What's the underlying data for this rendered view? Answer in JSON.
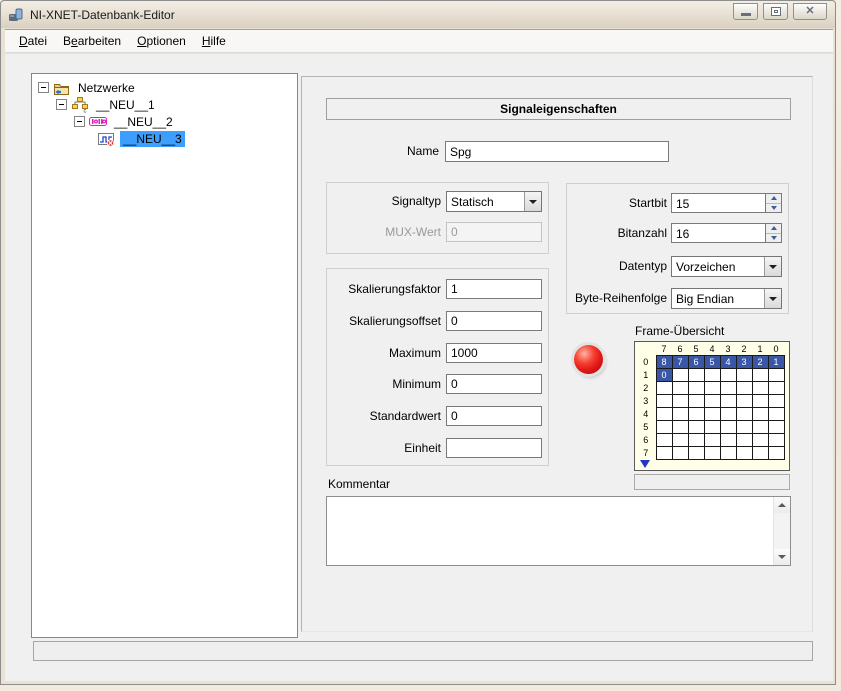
{
  "window": {
    "title": "NI-XNET-Datenbank-Editor"
  },
  "menu": {
    "items": [
      {
        "pre": "",
        "key": "D",
        "post": "atei"
      },
      {
        "pre": "B",
        "key": "e",
        "post": "arbeiten"
      },
      {
        "pre": "",
        "key": "O",
        "post": "ptionen"
      },
      {
        "pre": "",
        "key": "H",
        "post": "ilfe"
      }
    ]
  },
  "tree": {
    "items": [
      {
        "label": "Netzwerke",
        "icon": "network-folder-icon",
        "selected": false
      },
      {
        "label": "__NEU__1",
        "icon": "cluster-icon",
        "selected": false
      },
      {
        "label": "__NEU__2",
        "icon": "frame-icon",
        "selected": false
      },
      {
        "label": "__NEU__3",
        "icon": "signal-icon",
        "selected": true
      }
    ]
  },
  "signal": {
    "header": "Signaleigenschaften",
    "name_label": "Name",
    "name_value": "Spg",
    "signaltyp_label": "Signaltyp",
    "signaltyp_value": "Statisch",
    "mux_label": "MUX-Wert",
    "mux_value": "0",
    "startbit_label": "Startbit",
    "startbit_value": "15",
    "bitanzahl_label": "Bitanzahl",
    "bitanzahl_value": "16",
    "datentyp_label": "Datentyp",
    "datentyp_value": "Vorzeichen",
    "byteorder_label": "Byte-Reihenfolge",
    "byteorder_value": "Big Endian",
    "skalierungsfaktor_label": "Skalierungsfaktor",
    "skalierungsfaktor_value": "1",
    "skalierungsoffset_label": "Skalierungsoffset",
    "skalierungsoffset_value": "0",
    "maximum_label": "Maximum",
    "maximum_value": "1000",
    "minimum_label": "Minimum",
    "minimum_value": "0",
    "standardwert_label": "Standardwert",
    "standardwert_value": "0",
    "einheit_label": "Einheit",
    "einheit_value": "",
    "kommentar_label": "Kommentar",
    "kommentar_value": ""
  },
  "frame_overview": {
    "title": "Frame-Übersicht",
    "col_headers": [
      "7",
      "6",
      "5",
      "4",
      "3",
      "2",
      "1",
      "0"
    ],
    "row_headers": [
      "0",
      "1",
      "2",
      "3",
      "4",
      "5",
      "6",
      "7"
    ],
    "cells": [
      [
        "8",
        "7",
        "6",
        "5",
        "4",
        "3",
        "2",
        "1"
      ],
      [
        "0",
        "",
        "",
        "",
        "",
        "",
        "",
        ""
      ],
      [
        "",
        "",
        "",
        "",
        "",
        "",
        "",
        ""
      ],
      [
        "",
        "",
        "",
        "",
        "",
        "",
        "",
        ""
      ],
      [
        "",
        "",
        "",
        "",
        "",
        "",
        "",
        ""
      ],
      [
        "",
        "",
        "",
        "",
        "",
        "",
        "",
        ""
      ],
      [
        "",
        "",
        "",
        "",
        "",
        "",
        "",
        ""
      ],
      [
        "",
        "",
        "",
        "",
        "",
        "",
        "",
        ""
      ]
    ],
    "filled_color": "#3A57A7"
  },
  "icons": {
    "close_glyph": "✕"
  },
  "colors": {
    "selection_blue": "#3E9EFE",
    "grid_fill_blue": "#3A57A7",
    "led_red": "#E01818",
    "grid_background": "#FFFFE8",
    "titlebar_beige": "#E6DFD1"
  }
}
